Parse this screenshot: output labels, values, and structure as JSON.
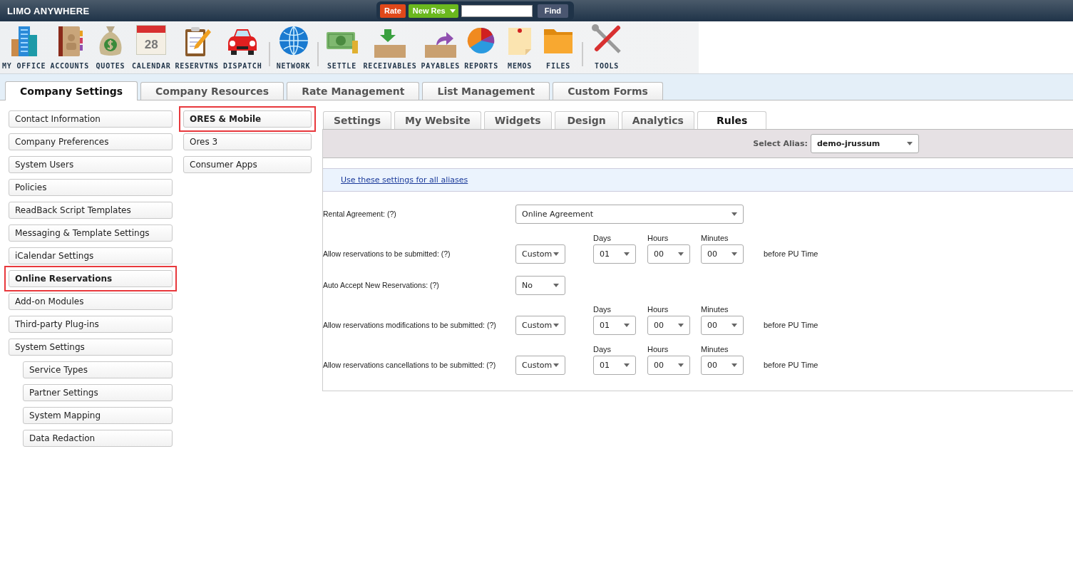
{
  "header": {
    "logo": "LIMO ANYWHERE",
    "rate_button": "Rate",
    "new_res_button": "New Res",
    "find_button": "Find"
  },
  "toolbar": [
    {
      "kind": "office",
      "label": "MY OFFICE"
    },
    {
      "kind": "accounts",
      "label": "ACCOUNTS"
    },
    {
      "kind": "quotes",
      "label": "QUOTES"
    },
    {
      "kind": "calendar",
      "label": "CALENDAR",
      "icon_text": "28"
    },
    {
      "kind": "reservations",
      "label": "RESERVTNS"
    },
    {
      "kind": "dispatch",
      "label": "DISPATCH"
    },
    {
      "kind": "separator"
    },
    {
      "kind": "network",
      "label": "NETWORK"
    },
    {
      "kind": "separator"
    },
    {
      "kind": "settle",
      "label": "SETTLE"
    },
    {
      "kind": "receivables",
      "label": "RECEIVABLES"
    },
    {
      "kind": "payables",
      "label": "PAYABLES"
    },
    {
      "kind": "reports",
      "label": "REPORTS"
    },
    {
      "kind": "memos",
      "label": "MEMOS"
    },
    {
      "kind": "files",
      "label": "FILES"
    },
    {
      "kind": "separator"
    },
    {
      "kind": "tools",
      "label": "TOOLS"
    }
  ],
  "main_tabs": [
    {
      "label": "Company Settings",
      "selected": true
    },
    {
      "label": "Company Resources",
      "selected": false
    },
    {
      "label": "Rate Management",
      "selected": false
    },
    {
      "label": "List Management",
      "selected": false
    },
    {
      "label": "Custom Forms",
      "selected": false
    }
  ],
  "sidebar": {
    "items": [
      {
        "label": "Contact Information",
        "selected": false,
        "highlighted": false
      },
      {
        "label": "Company Preferences",
        "selected": false,
        "highlighted": false
      },
      {
        "label": "System Users",
        "selected": false,
        "highlighted": false
      },
      {
        "label": "Policies",
        "selected": false,
        "highlighted": false
      },
      {
        "label": "ReadBack Script Templates",
        "selected": false,
        "highlighted": false
      },
      {
        "label": "Messaging & Template Settings",
        "selected": false,
        "highlighted": false
      },
      {
        "label": "iCalendar Settings",
        "selected": false,
        "highlighted": false
      },
      {
        "label": "Online Reservations",
        "selected": true,
        "highlighted": true
      },
      {
        "label": "Add-on Modules",
        "selected": false,
        "highlighted": false
      },
      {
        "label": "Third-party Plug-ins",
        "selected": false,
        "highlighted": false
      },
      {
        "label": "System Settings",
        "selected": false,
        "highlighted": false,
        "children": [
          {
            "label": "Service Types",
            "selected": false,
            "highlighted": false
          },
          {
            "label": "Partner Settings",
            "selected": false,
            "highlighted": false
          },
          {
            "label": "System Mapping",
            "selected": false,
            "highlighted": false
          },
          {
            "label": "Data Redaction",
            "selected": false,
            "highlighted": false
          }
        ]
      }
    ]
  },
  "submenu": {
    "items": [
      {
        "label": "ORES & Mobile",
        "selected": true,
        "highlighted": true
      },
      {
        "label": "Ores 3",
        "selected": false,
        "highlighted": false
      },
      {
        "label": "Consumer Apps",
        "selected": false,
        "highlighted": false
      }
    ]
  },
  "content": {
    "tabs": [
      {
        "label": "Settings",
        "selected": false
      },
      {
        "label": "My Website",
        "selected": false
      },
      {
        "label": "Widgets",
        "selected": false
      },
      {
        "label": "Design",
        "selected": false
      },
      {
        "label": "Analytics",
        "selected": false
      },
      {
        "label": "Rules",
        "selected": true
      }
    ],
    "alias_label": "Select Alias:",
    "alias_value": "demo-jrussum",
    "link": "Use these settings for all aliases",
    "rows": [
      {
        "kind": "select",
        "label": "Rental Agreement: (?)",
        "value": "Online Agreement"
      },
      {
        "kind": "timing",
        "label": "Allow reservations to be submitted: (?)",
        "value": "Custom",
        "days_label": "Days",
        "days": "01",
        "hours_label": "Hours",
        "hours": "00",
        "minutes_label": "Minutes",
        "minutes": "00",
        "suffix": "before PU Time"
      },
      {
        "kind": "short",
        "label": "Auto Accept New Reservations: (?)",
        "value": "No"
      },
      {
        "kind": "timing",
        "label": "Allow reservations modifications to be submitted: (?)",
        "value": "Custom",
        "days_label": "Days",
        "days": "01",
        "hours_label": "Hours",
        "hours": "00",
        "minutes_label": "Minutes",
        "minutes": "00",
        "suffix": "before PU Time"
      },
      {
        "kind": "timing",
        "label": "Allow reservations cancellations to be submitted: (?)",
        "value": "Custom",
        "days_label": "Days",
        "days": "01",
        "hours_label": "Hours",
        "hours": "00",
        "minutes_label": "Minutes",
        "minutes": "00",
        "suffix": "before PU Time"
      }
    ]
  }
}
